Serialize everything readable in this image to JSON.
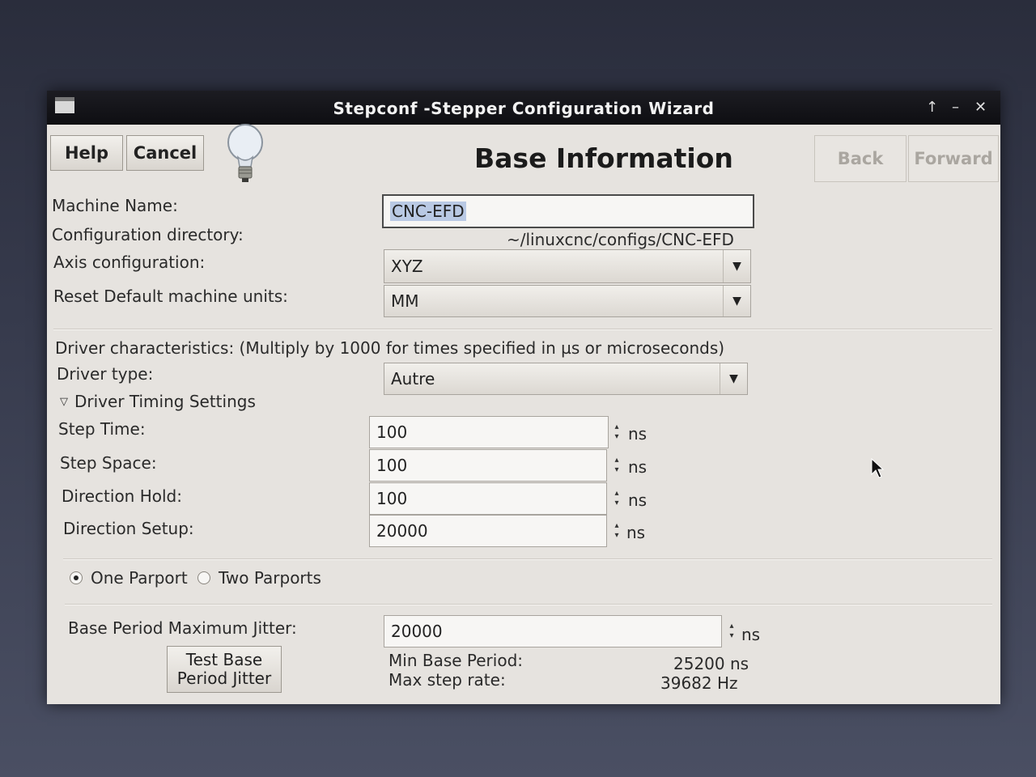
{
  "window": {
    "title": "Stepconf -Stepper Configuration Wizard"
  },
  "header": {
    "help_label": "Help",
    "cancel_label": "Cancel",
    "page_title": "Base Information",
    "back_label": "Back",
    "forward_label": "Forward"
  },
  "basic": {
    "machine_name_label": "Machine Name:",
    "machine_name_value": "CNC-EFD",
    "config_dir_label": "Configuration directory:",
    "config_dir_value": "~/linuxcnc/configs/CNC-EFD",
    "axis_label": "Axis configuration:",
    "axis_value": "XYZ",
    "units_label": "Reset Default machine units:",
    "units_value": "MM"
  },
  "driver": {
    "heading": "Driver characteristics: (Multiply by 1000 for times specified in µs or microseconds)",
    "type_label": "Driver type:",
    "type_value": "Autre",
    "timing_expander": "Driver Timing Settings",
    "rows": [
      {
        "label": "Step Time:",
        "value": "100",
        "unit": "ns"
      },
      {
        "label": "Step Space:",
        "value": "100",
        "unit": "ns"
      },
      {
        "label": "Direction Hold:",
        "value": "100",
        "unit": "ns"
      },
      {
        "label": "Direction Setup:",
        "value": "20000",
        "unit": "ns"
      }
    ]
  },
  "parport": {
    "one_label": "One Parport",
    "two_label": "Two Parports",
    "selected": "one"
  },
  "jitter": {
    "label": "Base Period Maximum Jitter:",
    "value": "20000",
    "unit": "ns",
    "test_button_line1": "Test Base",
    "test_button_line2": "Period Jitter",
    "min_period_label": "Min Base Period:",
    "min_period_value": "25200 ns",
    "max_rate_label": "Max step rate:",
    "max_rate_value": "39682 Hz"
  }
}
